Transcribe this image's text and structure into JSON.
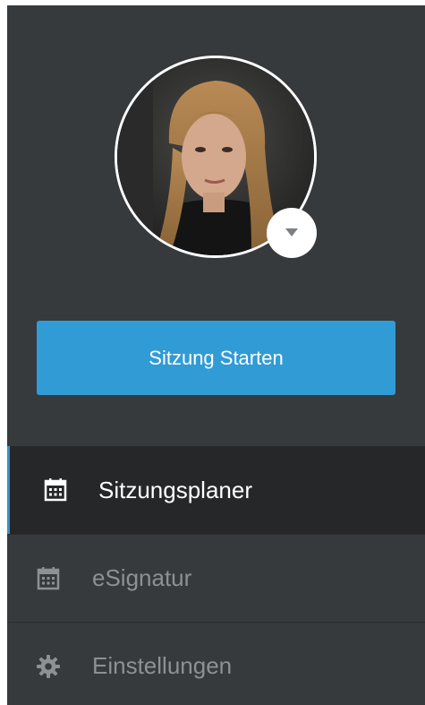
{
  "start_button": {
    "label": "Sitzung Starten"
  },
  "nav": {
    "items": [
      {
        "label": "Sitzungsplaner",
        "icon": "calendar-icon",
        "active": true
      },
      {
        "label": "eSignatur",
        "icon": "calendar-icon",
        "active": false
      },
      {
        "label": "Einstellungen",
        "icon": "gear-icon",
        "active": false
      }
    ]
  },
  "colors": {
    "sidebar_bg": "#373a3d",
    "active_bg": "#252728",
    "accent": "#319bd6",
    "active_text": "#ffffff",
    "inactive_text": "#8e9193"
  }
}
